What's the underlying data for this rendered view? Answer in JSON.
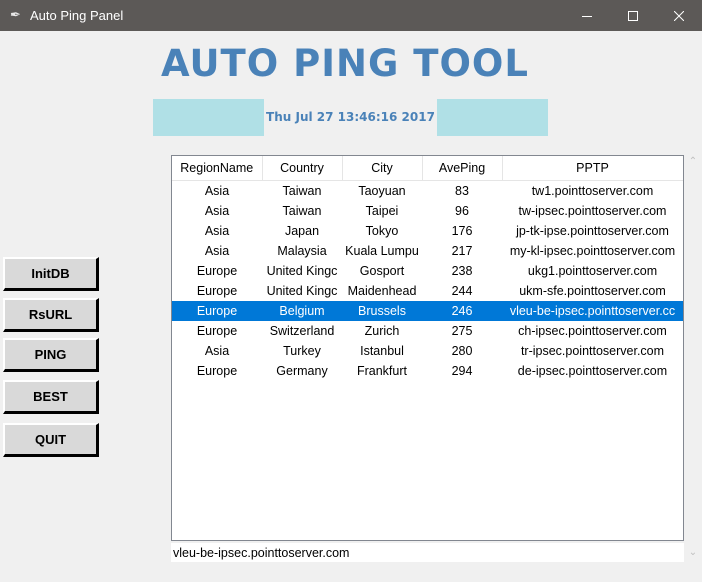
{
  "window": {
    "title": "Auto Ping Panel"
  },
  "heading": "AUTO  PING  TOOL",
  "clock": "Thu Jul 27 13:46:16 2017",
  "buttons": {
    "initdb": "InitDB",
    "rsurl": "RsURL",
    "ping": "PING",
    "best": "BEST",
    "quit": "QUIT"
  },
  "table": {
    "columns": [
      "RegionName",
      "Country",
      "City",
      "AvePing",
      "PPTP"
    ],
    "rows": [
      [
        "Asia",
        "Taiwan",
        "Taoyuan",
        "83",
        "tw1.pointtoserver.com"
      ],
      [
        "Asia",
        "Taiwan",
        "Taipei",
        "96",
        "tw-ipsec.pointtoserver.com"
      ],
      [
        "Asia",
        "Japan",
        "Tokyo",
        "176",
        "jp-tk-ipse.pointtoserver.com"
      ],
      [
        "Asia",
        "Malaysia",
        "Kuala Lumpu",
        "217",
        "my-kl-ipsec.pointtoserver.com"
      ],
      [
        "Europe",
        "United Kingc",
        "Gosport",
        "238",
        "ukg1.pointtoserver.com"
      ],
      [
        "Europe",
        "United Kingc",
        "Maidenhead",
        "244",
        "ukm-sfe.pointtoserver.com"
      ],
      [
        "Europe",
        "Belgium",
        "Brussels",
        "246",
        "vleu-be-ipsec.pointtoserver.cc"
      ],
      [
        "Europe",
        "Switzerland",
        "Zurich",
        "275",
        "ch-ipsec.pointtoserver.com"
      ],
      [
        "Asia",
        "Turkey",
        "Istanbul",
        "280",
        "tr-ipsec.pointtoserver.com"
      ],
      [
        "Europe",
        "Germany",
        "Frankfurt",
        "294",
        "de-ipsec.pointtoserver.com"
      ]
    ],
    "selected_row": 6
  },
  "entry": {
    "value": "vleu-be-ipsec.pointtoserver.com"
  },
  "colors": {
    "heading": "#4a82b8",
    "clock_bg": "#b0e0e6",
    "selection": "#0078d7",
    "titlebar": "#5c5957"
  }
}
